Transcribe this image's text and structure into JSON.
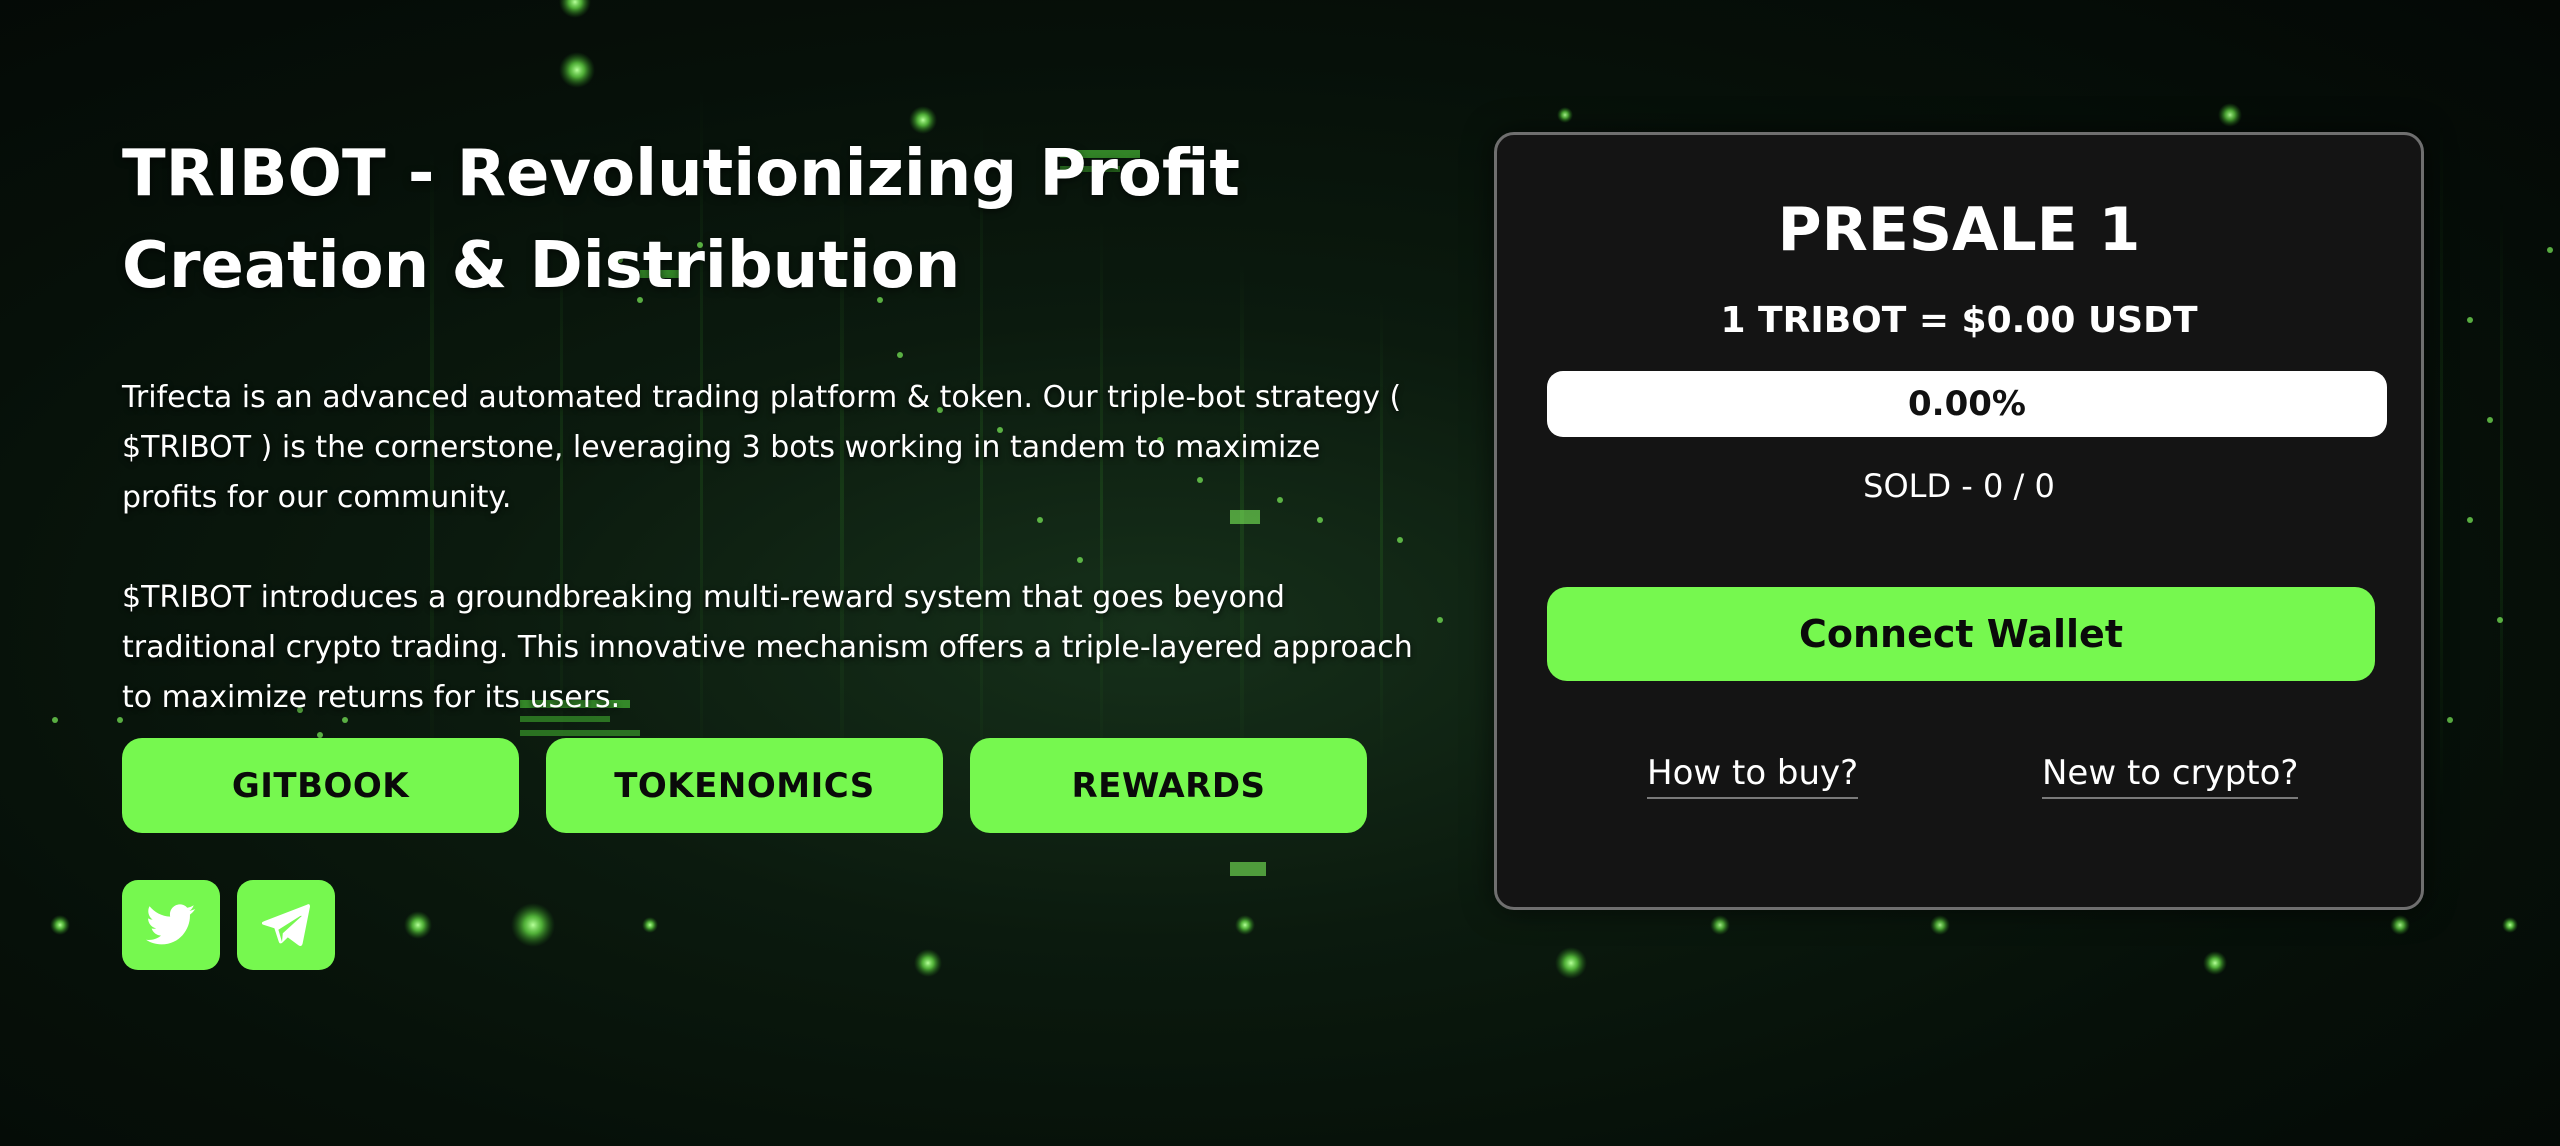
{
  "hero": {
    "title": "TRIBOT - Revolutionizing Profit Creation & Distribution",
    "paragraph_1": "Trifecta is an advanced automated trading platform & token. Our triple-bot strategy ( $TRIBOT ) is the cornerstone, leveraging 3 bots working in tandem to maximize profits for our community.",
    "paragraph_2": "$TRIBOT introduces a groundbreaking multi-reward system that goes beyond traditional crypto trading. This innovative mechanism offers a triple-layered approach to maximize returns for its users.",
    "buttons": [
      {
        "label": "GITBOOK"
      },
      {
        "label": "TOKENOMICS"
      },
      {
        "label": "REWARDS"
      }
    ],
    "social": [
      {
        "icon": "twitter-icon"
      },
      {
        "icon": "telegram-icon"
      }
    ]
  },
  "presale": {
    "title": "PRESALE 1",
    "price": "1 TRIBOT = $0.00 USDT",
    "progress_label": "0.00%",
    "progress_fraction": 0,
    "sold": "SOLD - 0 / 0",
    "connect_label": "Connect Wallet",
    "links": {
      "how_to_buy": "How to buy?",
      "new_to_crypto": "New to crypto?"
    }
  },
  "colors": {
    "accent": "#76f84f",
    "card_bg": "#141414",
    "card_border": "#6f6f6f",
    "background": "#061009"
  }
}
